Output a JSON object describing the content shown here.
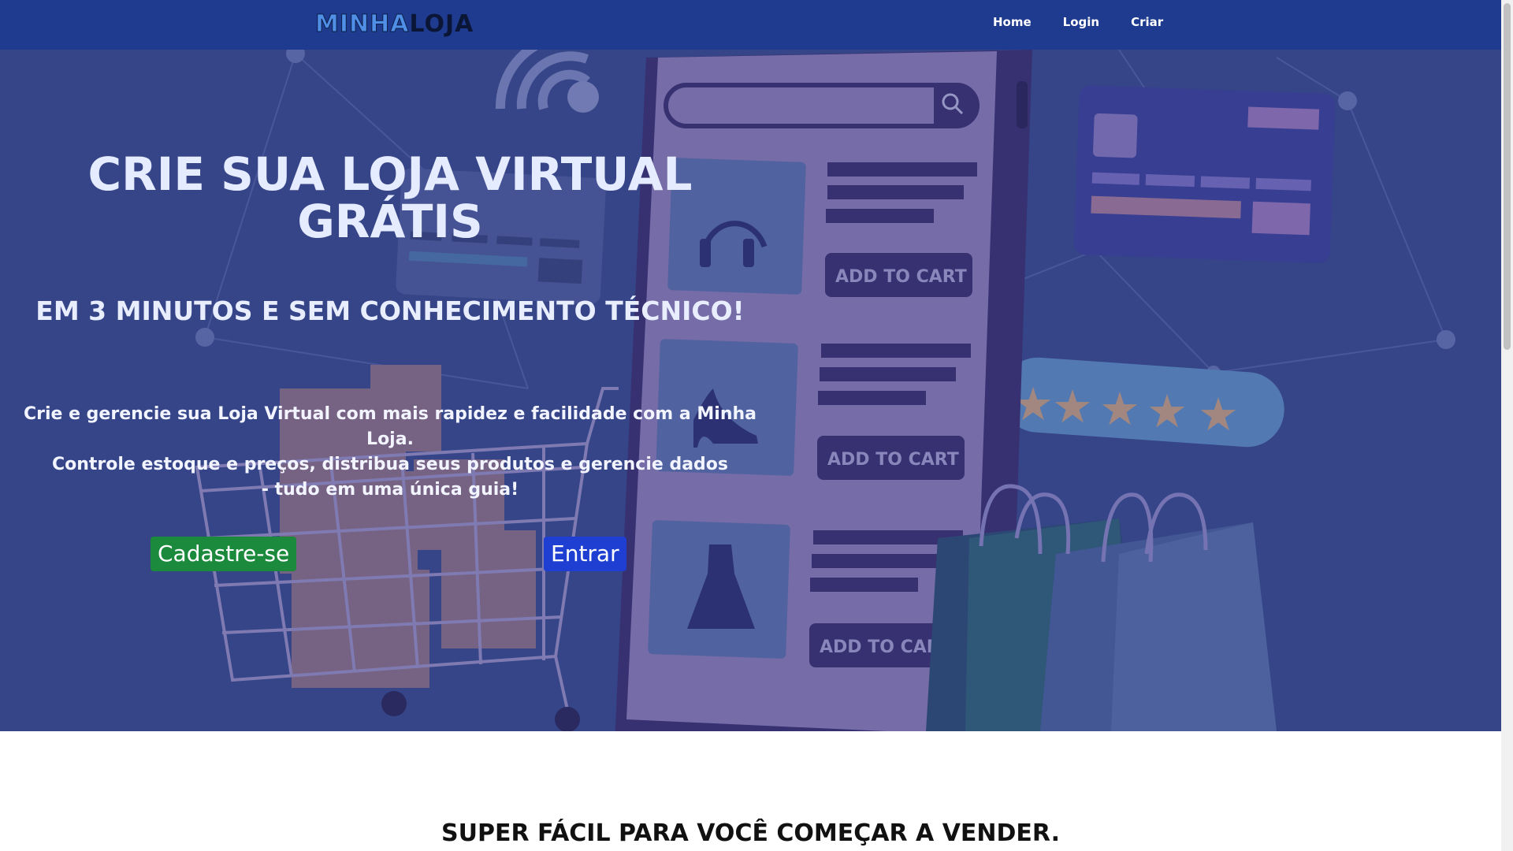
{
  "brand": {
    "part1": "MINHA",
    "part2": "LOJA"
  },
  "nav": {
    "items": [
      "Home",
      "Login",
      "Criar"
    ]
  },
  "hero": {
    "title_line1": "CRIE SUA LOJA VIRTUAL",
    "title_line2": "GRÁTIS",
    "subtitle": "EM 3 MINUTOS E SEM CONHECIMENTO TÉCNICO!",
    "desc_line1": "Crie e gerencie sua Loja Virtual com mais rapidez e facilidade com a Minha Loja.",
    "desc_line2": "Controle estoque e preços, distribua seus produtos e gerencie dados",
    "desc_line3": "- tudo em uma única guia!",
    "signup_label": "Cadastre-se",
    "enter_label": "Entrar",
    "illustration": {
      "add_to_cart": [
        "ADD TO CART",
        "ADD TO CART",
        "ADD TO CAR"
      ]
    }
  },
  "section": {
    "title": "SUPER FÁCIL PARA VOCÊ COMEÇAR A VENDER."
  },
  "colors": {
    "navbar": "#1f3b8f",
    "hero_bg": "#38488a",
    "signup": "#1b8a3c",
    "enter": "#1e3fd1"
  }
}
